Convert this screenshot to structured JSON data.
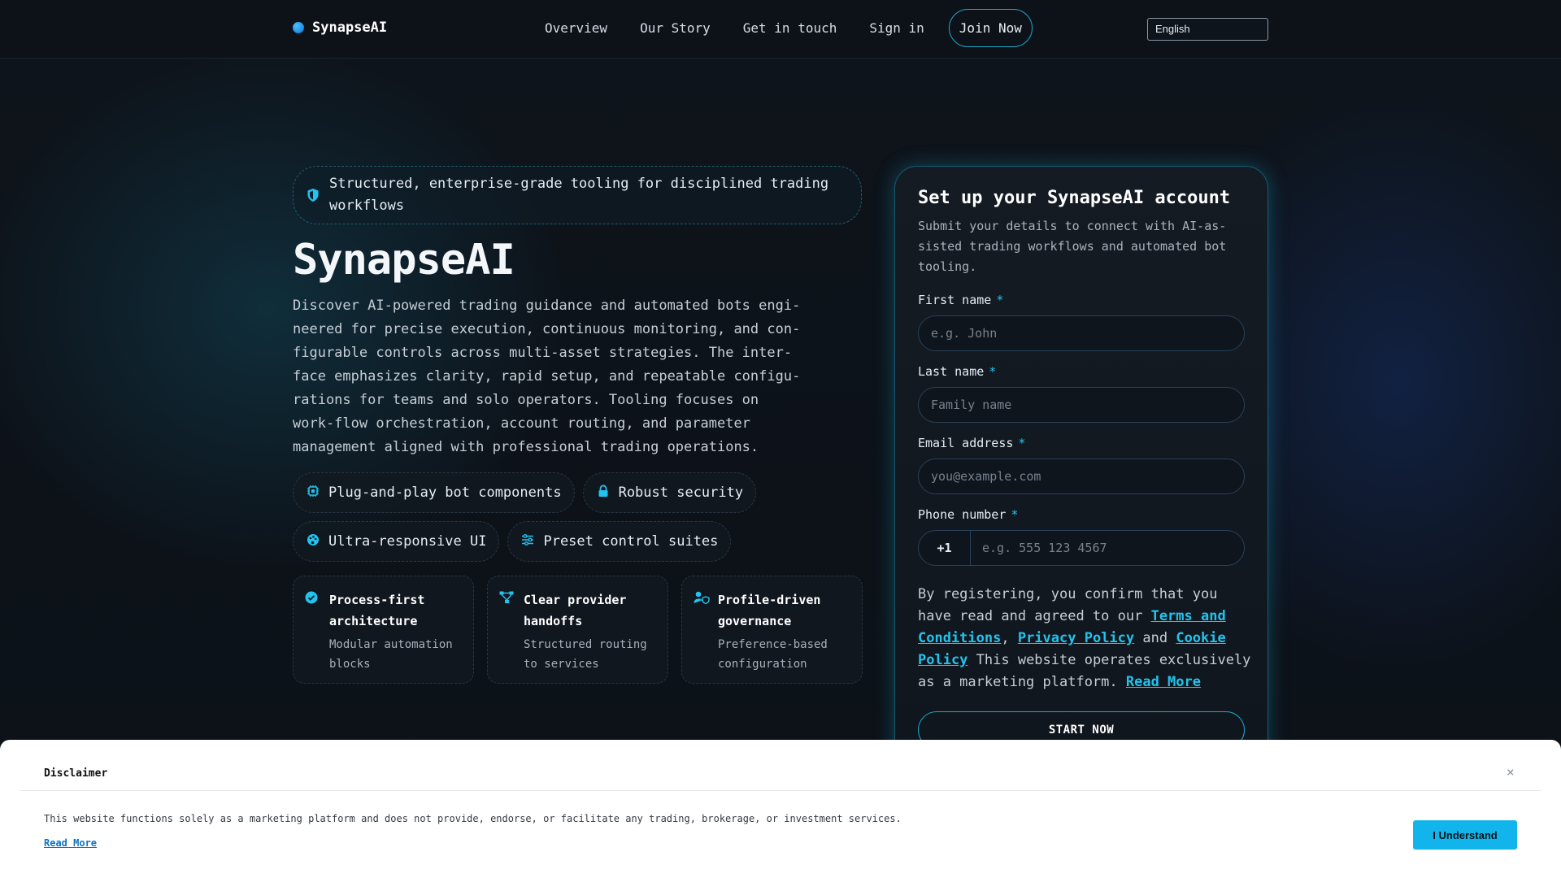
{
  "nav": {
    "brand": "SynapseAI",
    "links": [
      "Overview",
      "Our Story",
      "Get in touch",
      "Sign in"
    ],
    "join": "Join Now",
    "language": "English"
  },
  "hero": {
    "badge": "Structured, enterprise-grade tooling for disciplined trading workflows",
    "title": "SynapseAI",
    "description": "Discover AI-powered trading guidance and automated bots engi-neered for precise execution, continuous monitoring, and con-figurable controls across multi-asset strategies. The inter-face emphasizes clarity, rapid setup, and repeatable configu-rations for teams and solo operators. Tooling focuses on work-flow orchestration, account routing, and parameter management aligned with professional trading operations.",
    "tags": [
      {
        "label": "Plug-and-play bot components",
        "icon": "chip-icon"
      },
      {
        "label": "Robust security",
        "icon": "lock-icon"
      },
      {
        "label": "Ultra-responsive UI",
        "icon": "palette-icon"
      },
      {
        "label": "Preset control suites",
        "icon": "sliders-icon"
      }
    ],
    "cards": [
      {
        "title": "Process-first architecture",
        "sub": "Modular automation blocks",
        "icon": "check-circle-icon"
      },
      {
        "title": "Clear provider handoffs",
        "sub": "Structured routing to services",
        "icon": "network-icon"
      },
      {
        "title": "Profile-driven governance",
        "sub": "Preference-based configuration",
        "icon": "user-shield-icon"
      }
    ]
  },
  "form": {
    "title": "Set up your SynapseAI account",
    "subtitle": "Submit your details to connect with AI-as-sisted trading workflows and automated bot tooling.",
    "first_name_label": "First name",
    "first_name_placeholder": "e.g. John",
    "last_name_label": "Last name",
    "last_name_placeholder": "Family name",
    "email_label": "Email address",
    "email_placeholder": "you@example.com",
    "phone_label": "Phone number",
    "phone_code": "+1",
    "phone_placeholder": "e.g. 555 123 4567",
    "required_mark": "*",
    "consent_prefix": "By registering, you confirm that you have read and agreed to our ",
    "terms": "Terms and Conditions",
    "comma": ", ",
    "privacy": "Privacy Policy",
    "and": " and ",
    "cookie": "Cookie Policy",
    "consent_suffix": " This website operates exclusively as a marketing platform. ",
    "read_more": "Read More",
    "submit": "START NOW"
  },
  "disclaimer": {
    "title": "Disclaimer",
    "text": "This website functions solely as a marketing platform and does not provide, endorse, or facilitate any trading, brokerage, or investment services.",
    "read_more": "Read More",
    "button": "I Understand",
    "close": "×"
  },
  "colors": {
    "accent": "#22c3ee",
    "background": "#0d1219",
    "button": "#11b5ec"
  }
}
